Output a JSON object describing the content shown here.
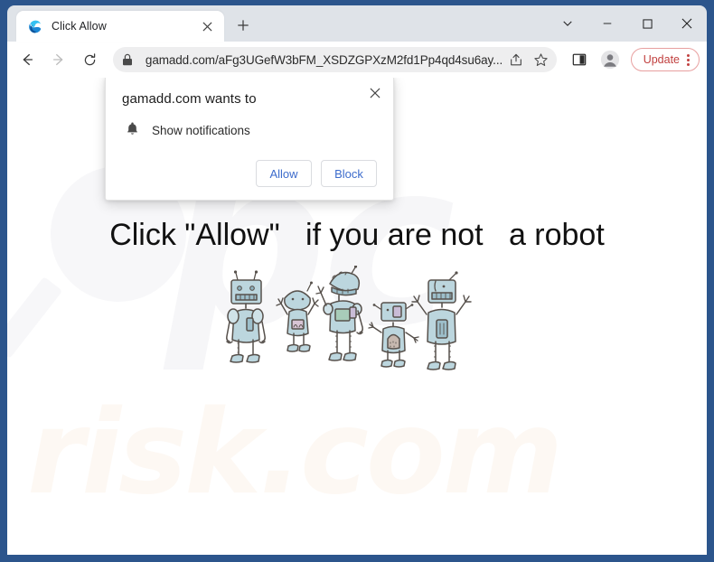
{
  "window": {
    "controls": {
      "tab_actions_label": "tab-actions-chevron",
      "minimize_label": "minimize",
      "maximize_label": "maximize",
      "close_label": "close"
    }
  },
  "tab_strip": {
    "tabs": [
      {
        "title": "Click Allow",
        "favicon": "edge-favicon",
        "close_label": "×"
      }
    ],
    "new_tab_label": "+"
  },
  "toolbar": {
    "back_label": "back-arrow",
    "forward_label": "forward-arrow",
    "reload_label": "reload",
    "lock_label": "lock-icon",
    "url": "gamadd.com/aFg3UGefW3bFM_XSDZGPXzM2fd1Pp4qd4su6ay...",
    "share_label": "share-icon",
    "favorite_label": "star-icon",
    "split_screen_label": "split-screen-icon",
    "profile_label": "profile-avatar",
    "update_label": "Update",
    "settings_label": "settings-and-more"
  },
  "dialog": {
    "title": "gamadd.com wants to",
    "permission_icon": "bell-icon",
    "permission_label": "Show notifications",
    "allow_label": "Allow",
    "block_label": "Block",
    "close_label": "×"
  },
  "page": {
    "headline": "Click \"Allow\"   if you are not   a robot",
    "illustration_alt": "five-cartoon-robots",
    "watermark_top": "pc",
    "watermark_bottom": "risk.com"
  },
  "colors": {
    "window_frame": "#2c558c",
    "tab_strip": "#dfe3e8",
    "address_bar": "#eeeeef",
    "update_accent": "#c1403f",
    "dialog_button_text": "#3d6ccc",
    "robot_body": "#b9d4dc",
    "robot_outline": "#5a5550"
  }
}
